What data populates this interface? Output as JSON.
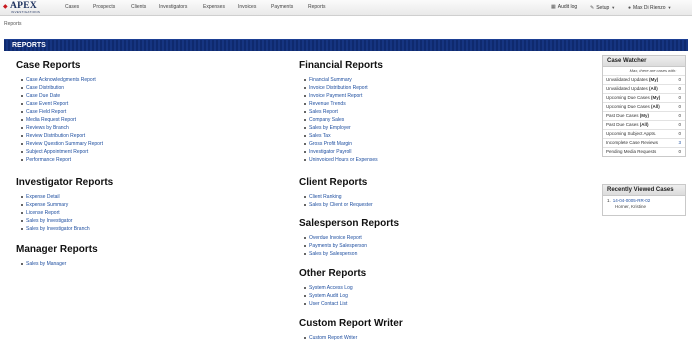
{
  "brand": {
    "name": "APEX",
    "tagline": "INVESTIGATIONS"
  },
  "nav": {
    "items": [
      "Cases",
      "Prospects",
      "Clients",
      "Investigators",
      "Expenses",
      "Invoices",
      "Payments",
      "Reports"
    ],
    "audit_log": "Audit log",
    "setup": "Setup",
    "user": "Max Di Rienzo"
  },
  "breadcrumb": "Reports",
  "page_title": "REPORTS",
  "sections": {
    "case": {
      "title": "Case Reports",
      "items": [
        "Case Acknowledgments Report",
        "Case Distribution",
        "Case Due Date",
        "Case Event Report",
        "Case Field Report",
        "Media Request Report",
        "Reviews by Branch",
        "Review Distribution Report",
        "Review Question Summary Report",
        "Subject Appointment Report",
        "Performance Report"
      ]
    },
    "investigator": {
      "title": "Investigator Reports",
      "items": [
        "Expense Detail",
        "Expense Summary",
        "License Report",
        "Sales by Investigator",
        "Sales by Investigator Branch"
      ]
    },
    "manager": {
      "title": "Manager Reports",
      "items": [
        "Sales by Manager"
      ]
    },
    "financial": {
      "title": "Financial Reports",
      "items": [
        "Financial Summary",
        "Invoice Distribution Report",
        "Invoice Payment Report",
        "Revenue Trends",
        "Sales Report",
        "Company Sales",
        "Sales by Employer",
        "Sales Tax",
        "Gross Profit Margin",
        "Investigator Payroll",
        "Uninvoiced Hours or Expenses"
      ]
    },
    "client": {
      "title": "Client Reports",
      "items": [
        "Client Ranking",
        "Sales by Client or Requester"
      ]
    },
    "salesperson": {
      "title": "Salesperson Reports",
      "items": [
        "Overdue Invoice Report",
        "Payments by Salesperson",
        "Sales by Salesperson"
      ]
    },
    "other": {
      "title": "Other Reports",
      "items": [
        "System Access Log",
        "System Audit Log",
        "User Contact List"
      ]
    },
    "custom": {
      "title": "Custom Report Writer",
      "items": [
        "Custom Report Writer"
      ]
    }
  },
  "case_watcher": {
    "title": "Case Watcher",
    "subtitle": "Max, there are cases with:",
    "rows": [
      {
        "label": "Unvalidated Updates",
        "qualifier": "(My)",
        "count": "0"
      },
      {
        "label": "Unvalidated Updates",
        "qualifier": "(All)",
        "count": "0"
      },
      {
        "label": "Upcoming Due Cases",
        "qualifier": "(My)",
        "count": "0"
      },
      {
        "label": "Upcoming Due Cases",
        "qualifier": "(All)",
        "count": "0"
      },
      {
        "label": "Past Due Cases",
        "qualifier": "(My)",
        "count": "0"
      },
      {
        "label": "Past Due Cases",
        "qualifier": "(All)",
        "count": "0"
      },
      {
        "label": "Upcoming Subject Appts.",
        "qualifier": "",
        "count": "0"
      },
      {
        "label": "Incomplete Case Reviews",
        "qualifier": "",
        "count": "3"
      },
      {
        "label": "Pending Media Requests",
        "qualifier": "",
        "count": "0"
      }
    ]
  },
  "recent_cases": {
    "title": "Recently Viewed Cases",
    "items": [
      {
        "number": "1.",
        "case_id": "14-04-0005-RR-02",
        "name": "Horner, Kristine"
      }
    ]
  },
  "colors": {
    "brand_navy": "#1a2e5c",
    "brand_red": "#c8191f",
    "link": "#1f4fa0",
    "title_bar": "#0f2a6e"
  }
}
